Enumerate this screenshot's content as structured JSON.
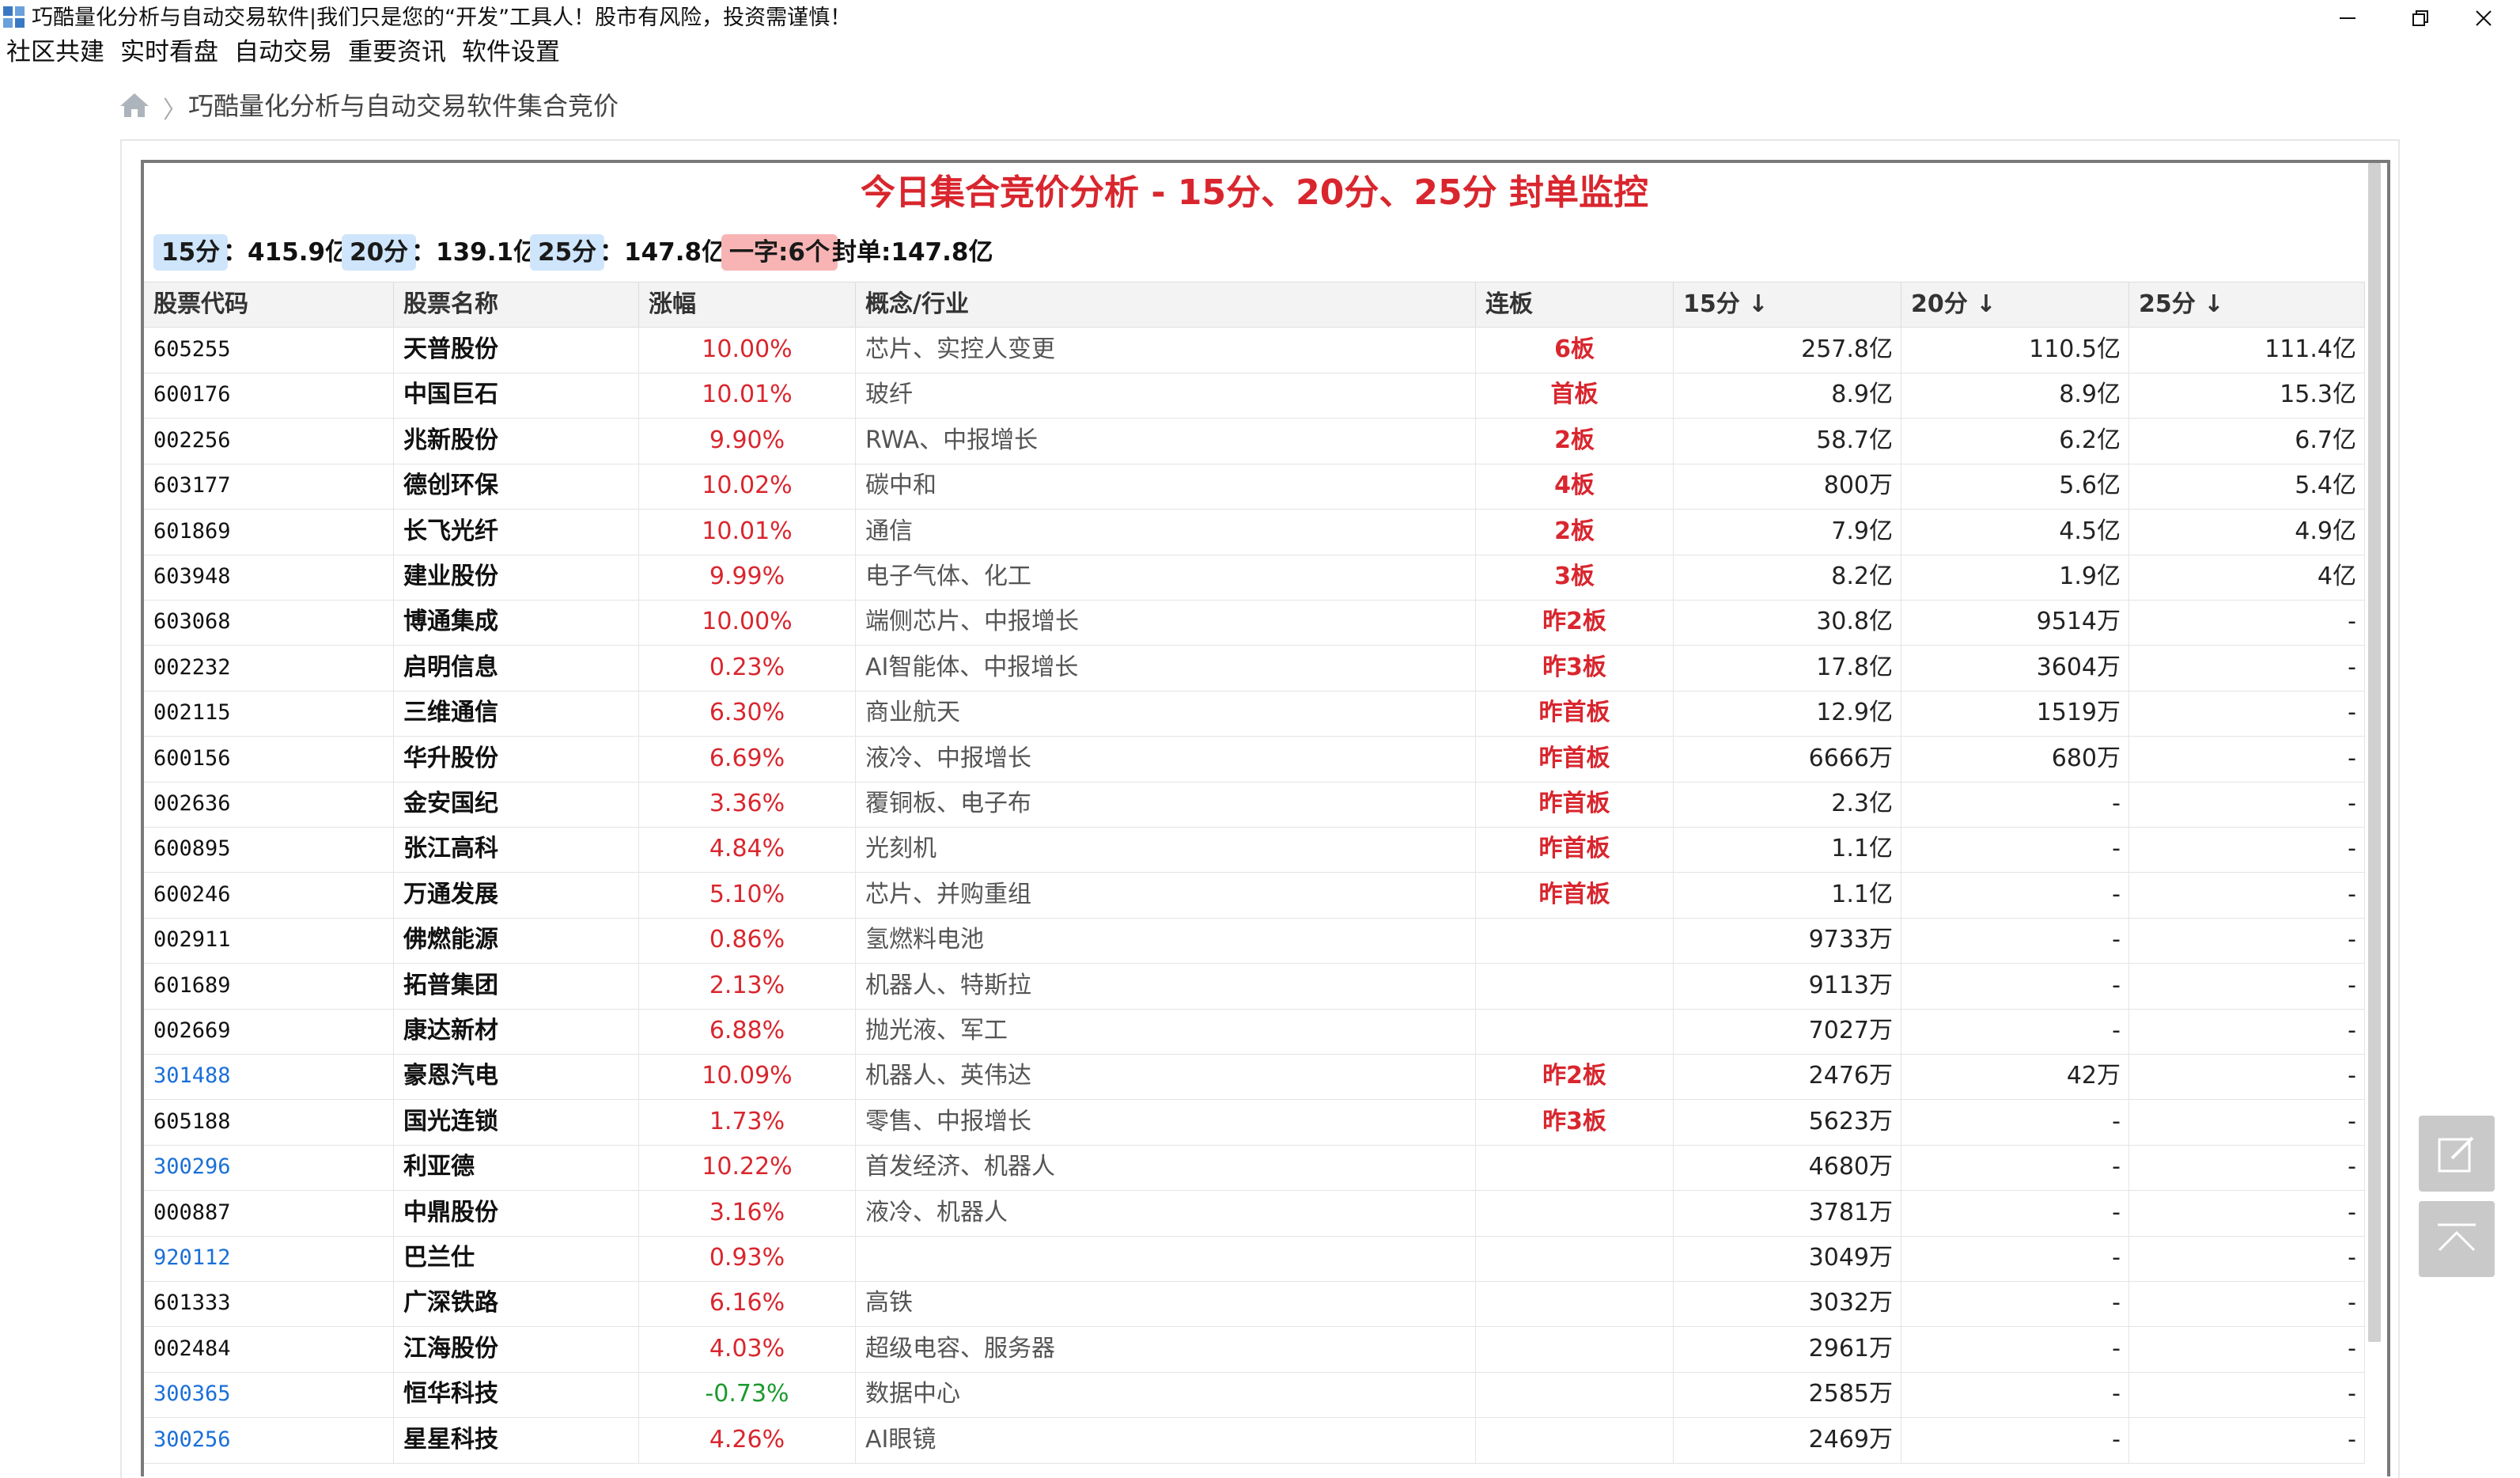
{
  "window": {
    "title": "巧酷量化分析与自动交易软件|我们只是您的“开发”工具人！股市有风险，投资需谨慎！"
  },
  "menu": [
    {
      "label": "社区共建"
    },
    {
      "label": "实时看盘"
    },
    {
      "label": "自动交易"
    },
    {
      "label": "重要资讯"
    },
    {
      "label": "软件设置"
    }
  ],
  "breadcrumb": {
    "text": "巧酷量化分析与自动交易软件集合竞价"
  },
  "main": {
    "title": "今日集合竞价分析 - 15分、20分、25分 封单监控",
    "summary": {
      "tag15": "15分",
      "val15": "：415.9亿",
      "tag20": "20分",
      "val20": "：139.1亿",
      "tag25": "25分",
      "val25": "：147.8亿",
      "tag_yizi": "一字:6个",
      "seal": "封单:147.8亿"
    }
  },
  "table": {
    "headers": {
      "code": "股票代码",
      "name": "股票名称",
      "pct": "涨幅",
      "concept": "概念/行业",
      "board": "连板",
      "m15": "15分 ↓",
      "m20": "20分 ↓",
      "m25": "25分 ↓"
    },
    "rows": [
      {
        "code": "605255",
        "name": "天普股份",
        "pct": "10.00%",
        "concept": "芯片、实控人变更",
        "board": "6板",
        "m15": "257.8亿",
        "m20": "110.5亿",
        "m25": "111.4亿",
        "link": false,
        "neg": false
      },
      {
        "code": "600176",
        "name": "中国巨石",
        "pct": "10.01%",
        "concept": "玻纤",
        "board": "首板",
        "m15": "8.9亿",
        "m20": "8.9亿",
        "m25": "15.3亿",
        "link": false,
        "neg": false
      },
      {
        "code": "002256",
        "name": "兆新股份",
        "pct": "9.90%",
        "concept": "RWA、中报增长",
        "board": "2板",
        "m15": "58.7亿",
        "m20": "6.2亿",
        "m25": "6.7亿",
        "link": false,
        "neg": false
      },
      {
        "code": "603177",
        "name": "德创环保",
        "pct": "10.02%",
        "concept": "碳中和",
        "board": "4板",
        "m15": "800万",
        "m20": "5.6亿",
        "m25": "5.4亿",
        "link": false,
        "neg": false
      },
      {
        "code": "601869",
        "name": "长飞光纤",
        "pct": "10.01%",
        "concept": "通信",
        "board": "2板",
        "m15": "7.9亿",
        "m20": "4.5亿",
        "m25": "4.9亿",
        "link": false,
        "neg": false
      },
      {
        "code": "603948",
        "name": "建业股份",
        "pct": "9.99%",
        "concept": "电子气体、化工",
        "board": "3板",
        "m15": "8.2亿",
        "m20": "1.9亿",
        "m25": "4亿",
        "link": false,
        "neg": false
      },
      {
        "code": "603068",
        "name": "博通集成",
        "pct": "10.00%",
        "concept": "端侧芯片、中报增长",
        "board": "昨2板",
        "m15": "30.8亿",
        "m20": "9514万",
        "m25": "-",
        "link": false,
        "neg": false
      },
      {
        "code": "002232",
        "name": "启明信息",
        "pct": "0.23%",
        "concept": "AI智能体、中报增长",
        "board": "昨3板",
        "m15": "17.8亿",
        "m20": "3604万",
        "m25": "-",
        "link": false,
        "neg": false
      },
      {
        "code": "002115",
        "name": "三维通信",
        "pct": "6.30%",
        "concept": "商业航天",
        "board": "昨首板",
        "m15": "12.9亿",
        "m20": "1519万",
        "m25": "-",
        "link": false,
        "neg": false
      },
      {
        "code": "600156",
        "name": "华升股份",
        "pct": "6.69%",
        "concept": "液冷、中报增长",
        "board": "昨首板",
        "m15": "6666万",
        "m20": "680万",
        "m25": "-",
        "link": false,
        "neg": false
      },
      {
        "code": "002636",
        "name": "金安国纪",
        "pct": "3.36%",
        "concept": "覆铜板、电子布",
        "board": "昨首板",
        "m15": "2.3亿",
        "m20": "-",
        "m25": "-",
        "link": false,
        "neg": false
      },
      {
        "code": "600895",
        "name": "张江高科",
        "pct": "4.84%",
        "concept": "光刻机",
        "board": "昨首板",
        "m15": "1.1亿",
        "m20": "-",
        "m25": "-",
        "link": false,
        "neg": false
      },
      {
        "code": "600246",
        "name": "万通发展",
        "pct": "5.10%",
        "concept": "芯片、并购重组",
        "board": "昨首板",
        "m15": "1.1亿",
        "m20": "-",
        "m25": "-",
        "link": false,
        "neg": false
      },
      {
        "code": "002911",
        "name": "佛燃能源",
        "pct": "0.86%",
        "concept": "氢燃料电池",
        "board": "",
        "m15": "9733万",
        "m20": "-",
        "m25": "-",
        "link": false,
        "neg": false
      },
      {
        "code": "601689",
        "name": "拓普集团",
        "pct": "2.13%",
        "concept": "机器人、特斯拉",
        "board": "",
        "m15": "9113万",
        "m20": "-",
        "m25": "-",
        "link": false,
        "neg": false
      },
      {
        "code": "002669",
        "name": "康达新材",
        "pct": "6.88%",
        "concept": "抛光液、军工",
        "board": "",
        "m15": "7027万",
        "m20": "-",
        "m25": "-",
        "link": false,
        "neg": false
      },
      {
        "code": "301488",
        "name": "豪恩汽电",
        "pct": "10.09%",
        "concept": "机器人、英伟达",
        "board": "昨2板",
        "m15": "2476万",
        "m20": "42万",
        "m25": "-",
        "link": true,
        "neg": false
      },
      {
        "code": "605188",
        "name": "国光连锁",
        "pct": "1.73%",
        "concept": "零售、中报增长",
        "board": "昨3板",
        "m15": "5623万",
        "m20": "-",
        "m25": "-",
        "link": false,
        "neg": false
      },
      {
        "code": "300296",
        "name": "利亚德",
        "pct": "10.22%",
        "concept": "首发经济、机器人",
        "board": "",
        "m15": "4680万",
        "m20": "-",
        "m25": "-",
        "link": true,
        "neg": false
      },
      {
        "code": "000887",
        "name": "中鼎股份",
        "pct": "3.16%",
        "concept": "液冷、机器人",
        "board": "",
        "m15": "3781万",
        "m20": "-",
        "m25": "-",
        "link": false,
        "neg": false
      },
      {
        "code": "920112",
        "name": "巴兰仕",
        "pct": "0.93%",
        "concept": "",
        "board": "",
        "m15": "3049万",
        "m20": "-",
        "m25": "-",
        "link": true,
        "neg": false
      },
      {
        "code": "601333",
        "name": "广深铁路",
        "pct": "6.16%",
        "concept": "高铁",
        "board": "",
        "m15": "3032万",
        "m20": "-",
        "m25": "-",
        "link": false,
        "neg": false
      },
      {
        "code": "002484",
        "name": "江海股份",
        "pct": "4.03%",
        "concept": "超级电容、服务器",
        "board": "",
        "m15": "2961万",
        "m20": "-",
        "m25": "-",
        "link": false,
        "neg": false
      },
      {
        "code": "300365",
        "name": "恒华科技",
        "pct": "-0.73%",
        "concept": "数据中心",
        "board": "",
        "m15": "2585万",
        "m20": "-",
        "m25": "-",
        "link": true,
        "neg": true
      },
      {
        "code": "300256",
        "name": "星星科技",
        "pct": "4.26%",
        "concept": "AI眼镜",
        "board": "",
        "m15": "2469万",
        "m20": "-",
        "m25": "-",
        "link": true,
        "neg": false
      }
    ]
  },
  "icons": {
    "app": "app-logo-icon",
    "home": "home-icon",
    "edit": "edit-icon",
    "top": "back-to-top-icon"
  },
  "colors": {
    "accent_red": "#d9262e",
    "link_blue": "#1a6fd8",
    "negative_green": "#1b9a2e",
    "tag_blue": "#cfe5fb",
    "tag_red": "#f8b4b4"
  }
}
